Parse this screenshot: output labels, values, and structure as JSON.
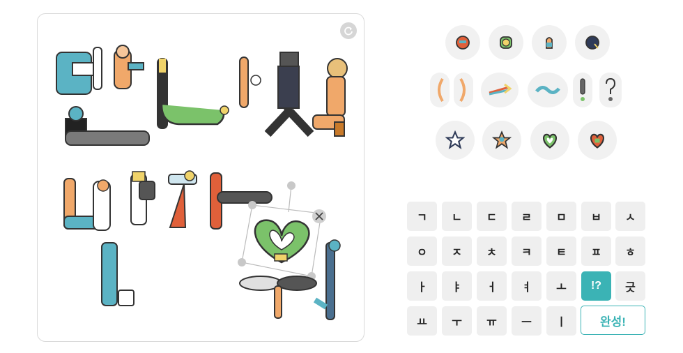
{
  "canvas": {
    "refresh_icon": "refresh-icon",
    "delete_icon": "close-icon"
  },
  "sticker_rows": [
    [
      "sticker-red-face",
      "sticker-green-face",
      "sticker-orange-hand",
      "sticker-navy-hair"
    ],
    [
      "sticker-left-paren",
      "sticker-right-paren",
      "sticker-arrow",
      "sticker-tilde",
      "sticker-exclamation",
      "sticker-question"
    ],
    [
      "sticker-star-outline",
      "sticker-star-figure",
      "sticker-green-heart",
      "sticker-red-heart"
    ]
  ],
  "keyboard": {
    "rows": [
      [
        "ㄱ",
        "ㄴ",
        "ㄷ",
        "ㄹ",
        "ㅁ",
        "ㅂ",
        "ㅅ"
      ],
      [
        "ㅇ",
        "ㅈ",
        "ㅊ",
        "ㅋ",
        "ㅌ",
        "ㅍ",
        "ㅎ"
      ],
      [
        "ㅏ",
        "ㅑ",
        "ㅓ",
        "ㅕ",
        "ㅗ",
        "!?",
        "긋"
      ],
      [
        "ㅛ",
        "ㅜ",
        "ㅠ",
        "ㅡ",
        "ㅣ"
      ]
    ],
    "done_label": "완성!",
    "accent_color": "#3bb3b5"
  }
}
